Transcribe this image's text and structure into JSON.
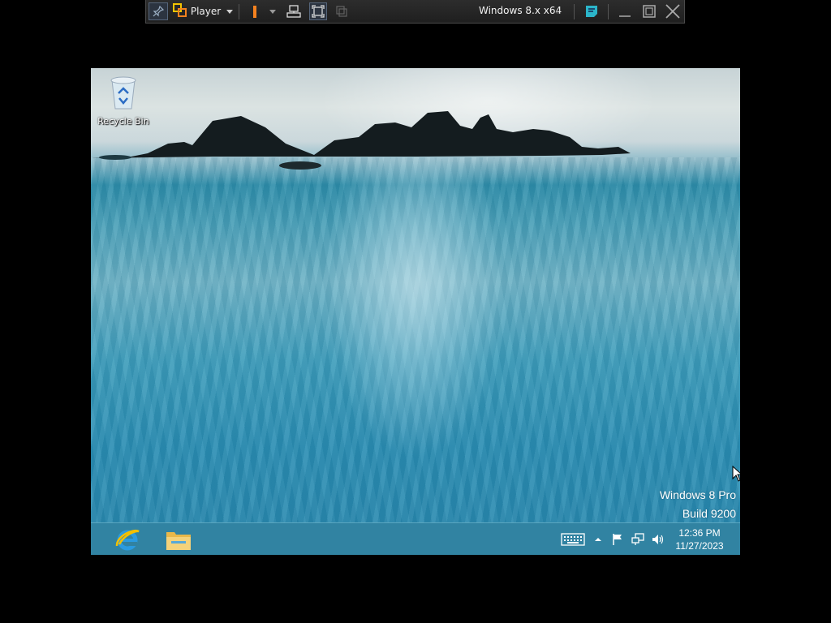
{
  "vm_toolbar": {
    "player_label": "Player",
    "vm_title": "Windows 8.x x64",
    "icons": [
      "pin-icon",
      "player-logo-icon",
      "pause-icon",
      "send-ctrl-alt-del-icon",
      "full-screen-icon",
      "unity-icon",
      "message-log-icon",
      "minimize-icon",
      "restore-icon",
      "close-icon"
    ],
    "accent": "#f5821f"
  },
  "desktop": {
    "icons": [
      {
        "label": "Recycle Bin",
        "icon": "recycle-bin-icon"
      }
    ],
    "watermark": {
      "edition": "Windows 8 Pro",
      "build": "Build 9200"
    }
  },
  "taskbar": {
    "apps": [
      {
        "name": "Internet Explorer",
        "icon": "internet-explorer-icon"
      },
      {
        "name": "File Explorer",
        "icon": "file-explorer-icon"
      }
    ],
    "tray_icons": [
      "touch-keyboard-icon",
      "show-hidden-icons-icon",
      "action-center-flag-icon",
      "network-icon",
      "volume-icon"
    ],
    "clock": {
      "time": "12:36 PM",
      "date": "11/27/2023"
    }
  }
}
